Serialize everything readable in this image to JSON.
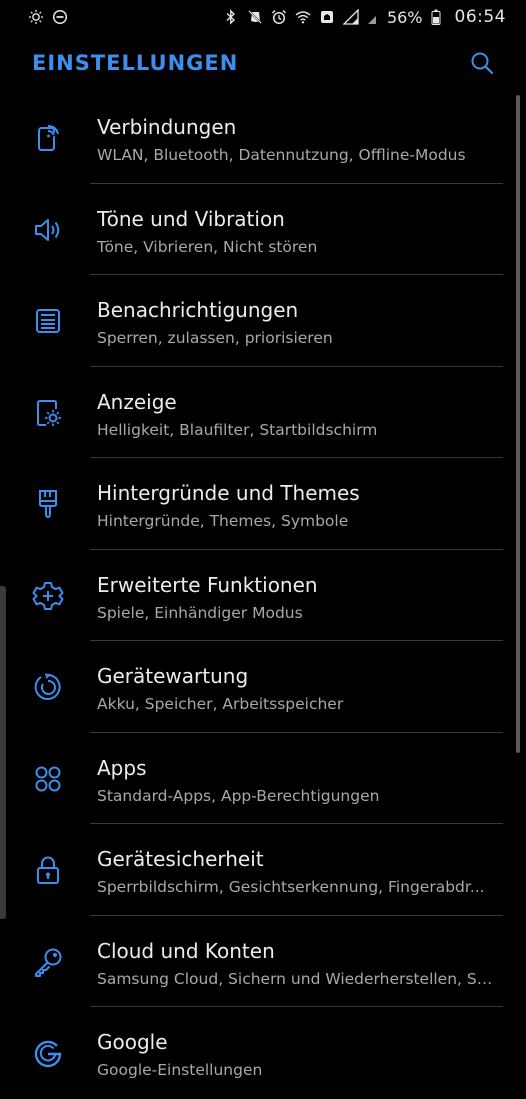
{
  "status_bar": {
    "battery_percent": "56%",
    "time": "06:54",
    "icons_left": [
      "brightness-auto-icon",
      "do-not-disturb-icon"
    ],
    "icons_right": [
      "bluetooth-icon",
      "vibrate-off-icon",
      "alarm-icon",
      "wifi-icon",
      "nfc-icon",
      "signal-icon",
      "signal-secondary-icon",
      "battery-icon"
    ]
  },
  "header": {
    "title": "EINSTELLUNGEN",
    "search_icon": "search-icon"
  },
  "colors": {
    "accent": "#3d8fef",
    "background": "#000000",
    "title_text": "#ececec",
    "subtitle_text": "#a8a8a8",
    "divider": "#3a3a3a"
  },
  "items": [
    {
      "id": "connections",
      "icon": "connections-icon",
      "title": "Verbindungen",
      "subtitle": "WLAN, Bluetooth, Datennutzung, Offline-Modus"
    },
    {
      "id": "sounds",
      "icon": "speaker-icon",
      "title": "Töne und Vibration",
      "subtitle": "Töne, Vibrieren, Nicht stören"
    },
    {
      "id": "notifications",
      "icon": "notifications-icon",
      "title": "Benachrichtigungen",
      "subtitle": "Sperren, zulassen, priorisieren"
    },
    {
      "id": "display",
      "icon": "display-icon",
      "title": "Anzeige",
      "subtitle": "Helligkeit, Blaufilter, Startbildschirm"
    },
    {
      "id": "wallpapers",
      "icon": "brush-icon",
      "title": "Hintergründe und Themes",
      "subtitle": "Hintergründe, Themes, Symbole"
    },
    {
      "id": "advanced",
      "icon": "advanced-features-icon",
      "title": "Erweiterte Funktionen",
      "subtitle": "Spiele, Einhändiger Modus"
    },
    {
      "id": "maintenance",
      "icon": "device-maintenance-icon",
      "title": "Gerätewartung",
      "subtitle": "Akku, Speicher, Arbeitsspeicher"
    },
    {
      "id": "apps",
      "icon": "apps-icon",
      "title": "Apps",
      "subtitle": "Standard-Apps, App-Berechtigungen"
    },
    {
      "id": "security",
      "icon": "lock-icon",
      "title": "Gerätesicherheit",
      "subtitle": "Sperrbildschirm, Gesichtserkennung, Fingerabdr..."
    },
    {
      "id": "cloud",
      "icon": "key-icon",
      "title": "Cloud und Konten",
      "subtitle": "Samsung Cloud, Sichern und Wiederherstellen, Sm..."
    },
    {
      "id": "google",
      "icon": "google-icon",
      "title": "Google",
      "subtitle": "Google-Einstellungen"
    }
  ]
}
